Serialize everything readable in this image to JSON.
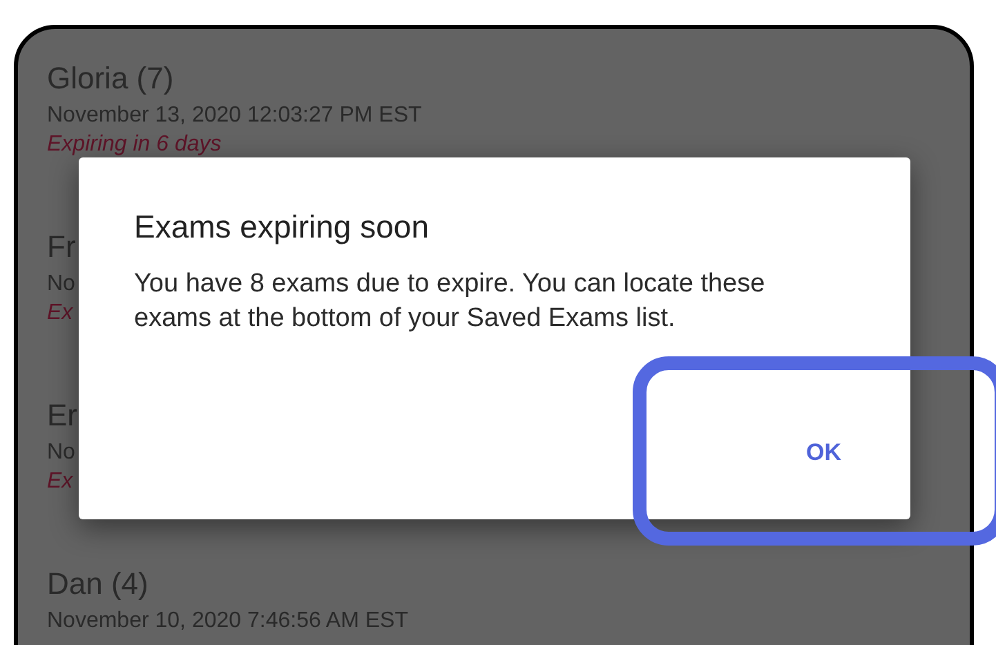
{
  "exams": [
    {
      "name": "Gloria (7)",
      "date": "November 13, 2020 12:03:27 PM EST",
      "expiry": "Expiring in 6 days"
    },
    {
      "name": "Fr",
      "date": "No",
      "expiry": "Ex"
    },
    {
      "name": "Er",
      "date": "No",
      "expiry": "Ex"
    },
    {
      "name": "Dan (4)",
      "date": "November 10, 2020 7:46:56 AM EST"
    }
  ],
  "dialog": {
    "title": "Exams expiring soon",
    "message": "You have 8 exams due to expire. You can locate these exams at the bottom of your Saved Exams list.",
    "buttons": [
      "OK"
    ]
  }
}
